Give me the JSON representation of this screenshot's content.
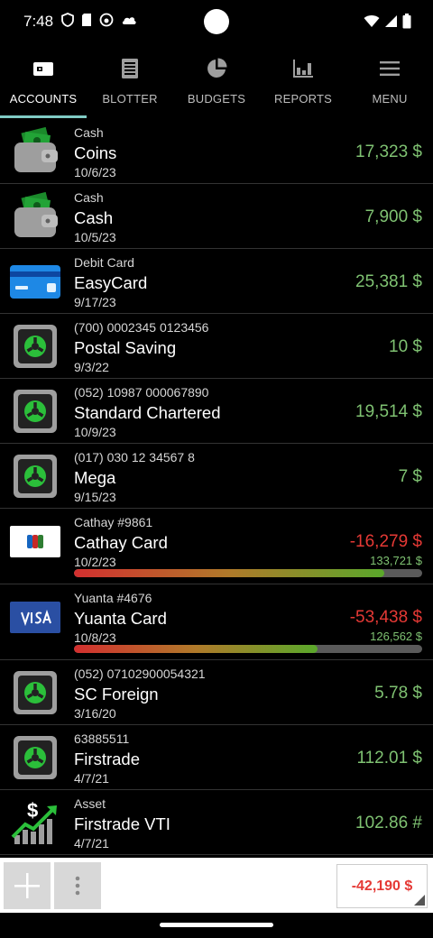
{
  "status_bar": {
    "time": "7:48"
  },
  "tabs": [
    {
      "label": "ACCOUNTS",
      "icon": "accounts-icon",
      "active": true
    },
    {
      "label": "BLOTTER",
      "icon": "blotter-icon",
      "active": false
    },
    {
      "label": "BUDGETS",
      "icon": "budgets-pie-icon",
      "active": false
    },
    {
      "label": "REPORTS",
      "icon": "reports-bar-icon",
      "active": false
    },
    {
      "label": "MENU",
      "icon": "menu-icon",
      "active": false
    }
  ],
  "accounts": [
    {
      "sub": "Cash",
      "name": "Coins",
      "date": "10/6/23",
      "amount": "17,323 $",
      "icon": "wallet-cash-icon"
    },
    {
      "sub": "Cash",
      "name": "Cash",
      "date": "10/5/23",
      "amount": "7,900 $",
      "icon": "wallet-cash-icon"
    },
    {
      "sub": "Debit Card",
      "name": "EasyCard",
      "date": "9/17/23",
      "amount": "25,381 $",
      "icon": "debit-card-icon"
    },
    {
      "sub": "(700) 0002345 0123456",
      "name": "Postal Saving",
      "date": "9/3/22",
      "amount": "10 $",
      "icon": "bank-safe-icon"
    },
    {
      "sub": "(052) 10987 000067890",
      "name": "Standard Chartered",
      "date": "10/9/23",
      "amount": "19,514 $",
      "icon": "bank-safe-icon"
    },
    {
      "sub": "(017) 030 12 34567 8",
      "name": "Mega",
      "date": "9/15/23",
      "amount": "7 $",
      "icon": "bank-safe-icon"
    },
    {
      "sub": "Cathay #9861",
      "name": "Cathay Card",
      "date": "10/2/23",
      "amount": "-16,279 $",
      "limit": "133,721 $",
      "usage": 0.89,
      "icon": "jcb-card-icon"
    },
    {
      "sub": "Yuanta #4676",
      "name": "Yuanta Card",
      "date": "10/8/23",
      "amount": "-53,438 $",
      "limit": "126,562 $",
      "usage": 0.7,
      "icon": "visa-card-icon"
    },
    {
      "sub": "(052) 07102900054321",
      "name": "SC Foreign",
      "date": "3/16/20",
      "amount": "5.78 $",
      "icon": "bank-safe-icon"
    },
    {
      "sub": "63885511",
      "name": "Firstrade",
      "date": "4/7/21",
      "amount": "112.01 $",
      "icon": "bank-safe-icon"
    },
    {
      "sub": "Asset",
      "name": "Firstrade VTI",
      "date": "4/7/21",
      "amount": "102.86 #",
      "icon": "asset-growth-icon"
    }
  ],
  "bottom": {
    "add": "add-icon",
    "more": "more-vert-icon",
    "total": "-42,190 $"
  },
  "colors": {
    "positive": "#7fc272",
    "negative": "#e53935",
    "indicator": "#80cbc4"
  }
}
